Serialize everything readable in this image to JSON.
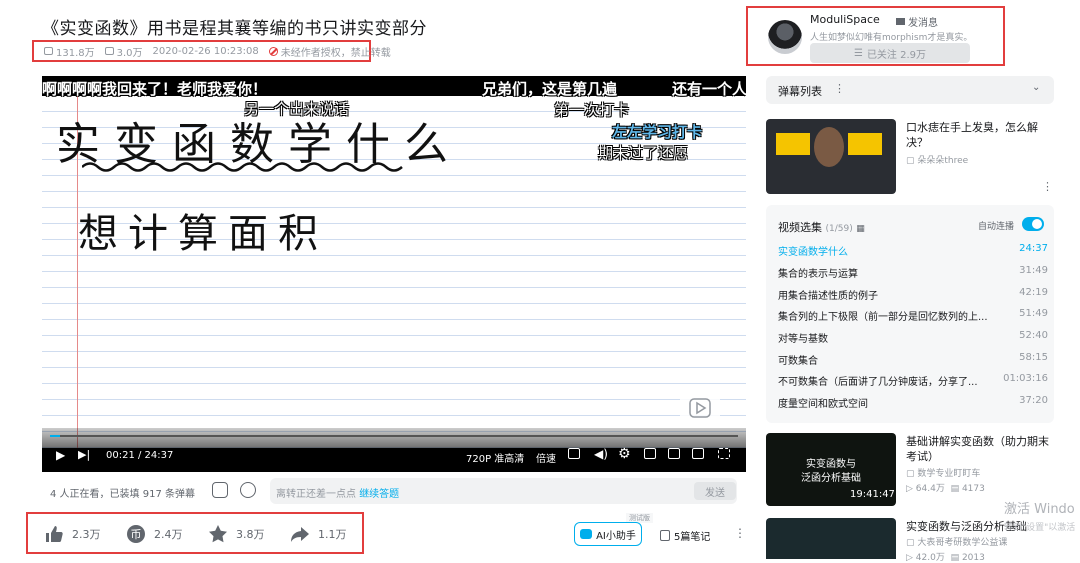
{
  "video": {
    "title": "《实变函数》用书是程其襄等编的书只讲实变部分",
    "views": "131.8万",
    "danmaku_count": "3.0万",
    "date": "2020-02-26 10:23:08",
    "copyright": "未经作者授权，禁止转载"
  },
  "uploader": {
    "name": "ModuliSpace",
    "message_label": "发消息",
    "signature": "人生如梦似幻唯有morphism才是真实。",
    "follow_label": "已关注 2.9万"
  },
  "player": {
    "handwriting_line1": "实变函数学什么",
    "handwriting_line2": "想计算面积",
    "danmaku": [
      "啊啊啊啊我回来了！老师我爱你！",
      "兄弟们，这是第几遍",
      "还有一个人",
      "另一个出来说话",
      "第一次打卡",
      "左左学习打卡",
      "期末过了还愿"
    ],
    "time": "00:21 / 24:37",
    "progress": 0.014,
    "quality": "720P 准高清",
    "speed": "倍速"
  },
  "danmaku_bar": {
    "viewers": "4 人正在看，已装填 917 条弹幕",
    "placeholder": "离转正还差一点点",
    "link": "继续答题",
    "send": "发送"
  },
  "toolbar": {
    "like": "2.3万",
    "coin": "2.4万",
    "fav": "3.8万",
    "share": "1.1万",
    "ai_label": "AI小助手",
    "ai_badge": "测试版",
    "notes": "5篇笔记"
  },
  "sidebar": {
    "danmaku_list": "弹幕列表",
    "rec1": {
      "title": "口水痣在手上发臭，怎么解决？",
      "author": "朵朵朵three"
    },
    "collection": {
      "title": "视频选集",
      "count": "(1/59)",
      "autoplay": "自动连播",
      "episodes": [
        {
          "name": "实变函数学什么",
          "dur": "24:37"
        },
        {
          "name": "集合的表示与运算",
          "dur": "31:49"
        },
        {
          "name": "用集合描述性质的例子",
          "dur": "42:19"
        },
        {
          "name": "集合列的上下极限（前一部分是回忆数列的上...",
          "dur": "51:49"
        },
        {
          "name": "对等与基数",
          "dur": "52:40"
        },
        {
          "name": "可数集合",
          "dur": "58:15"
        },
        {
          "name": "不可数集合（后面讲了几分钟废话，分享了...",
          "dur": "01:03:16"
        },
        {
          "name": "度量空间和欧式空间",
          "dur": "37:20"
        }
      ]
    },
    "rec2": {
      "title": "基础讲解实变函数（助力期末考试）",
      "author": "数学专业盯盯车",
      "views": "64.4万",
      "danmaku": "4173",
      "duration": "19:41:47",
      "thumb_text1": "实变函数与",
      "thumb_text2": "泛函分析基础"
    },
    "rec3": {
      "title": "实变函数与泛函分析基础",
      "author": "大表哥考研数学公益课",
      "views": "42.0万",
      "danmaku": "2013"
    }
  },
  "system": {
    "watermark": "激活 Windo",
    "watermark_sub": "转到\"设置\"以激活"
  }
}
